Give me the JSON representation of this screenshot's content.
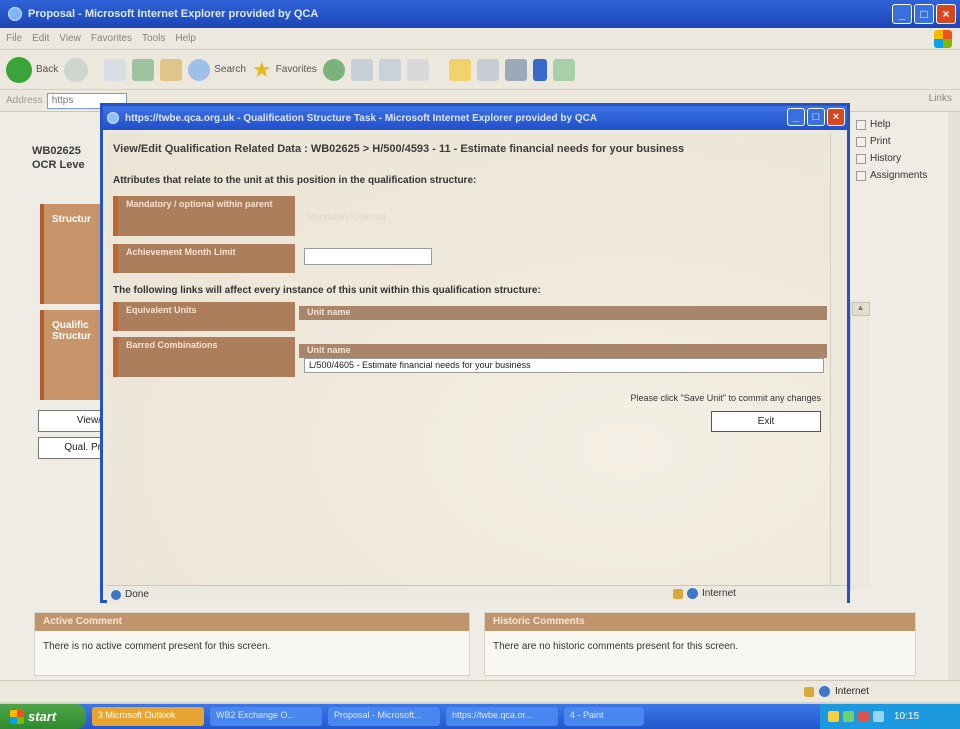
{
  "window": {
    "title": "Proposal - Microsoft Internet Explorer provided by QCA",
    "menu": [
      "File",
      "Edit",
      "View",
      "Favorites",
      "Tools",
      "Help"
    ]
  },
  "toolbar": {
    "back_label": "Back",
    "search_label": "Search",
    "favorites_label": "Favorites"
  },
  "address": {
    "label": "Address",
    "value": "https",
    "links_label": "Links"
  },
  "page": {
    "code_line1": "WB02625",
    "code_line2": "OCR Leve",
    "structure_label": "Structur",
    "qual_label1": "Qualific",
    "qual_label2": "Structur",
    "view_button": "View/",
    "qual_button": "Qual. Pr",
    "right_links": [
      "Help",
      "Print",
      "History",
      "Assignments"
    ],
    "active_comment": {
      "title": "Active Comment",
      "text": "There is no active comment present for this screen."
    },
    "historic_comments": {
      "title": "Historic Comments",
      "text": "There are no historic comments present for this screen."
    },
    "status_zone": "Internet"
  },
  "popup": {
    "title": "https://twbe.qca.org.uk - Qualification Structure Task - Microsoft Internet Explorer provided by QCA",
    "heading": "View/Edit Qualification Related Data : WB02625 > H/500/4593 - 11 - Estimate financial needs for your business",
    "attributes_heading": "Attributes that relate to the unit at this position in the qualification structure:",
    "mandatory_label": "Mandatory / optional within parent",
    "mandatory_value": "Mandatory/Optional",
    "achievement_label": "Achievement Month Limit",
    "achievement_value": "",
    "links_heading": "The following links will affect every instance of this unit within this qualification structure:",
    "equivalent_label": "Equivalent Units",
    "equivalent_col": "Unit name",
    "barred_label": "Barred Combinations",
    "barred_col": "Unit name",
    "barred_units": [
      "L/500/4605 - Estimate financial needs for your business"
    ],
    "save_hint": "Please click \"Save Unit\" to commit any changes",
    "exit_button": "Exit",
    "status_text": "Done",
    "status_zone": "Internet"
  },
  "taskbar": {
    "start": "start",
    "tasks": [
      "3 Microsoft Outlook",
      "WB2 Exchange O...",
      "Proposal - Microsoft...",
      "https://twbe.qca.or...",
      "4 - Paint"
    ],
    "clock": "10:15"
  }
}
